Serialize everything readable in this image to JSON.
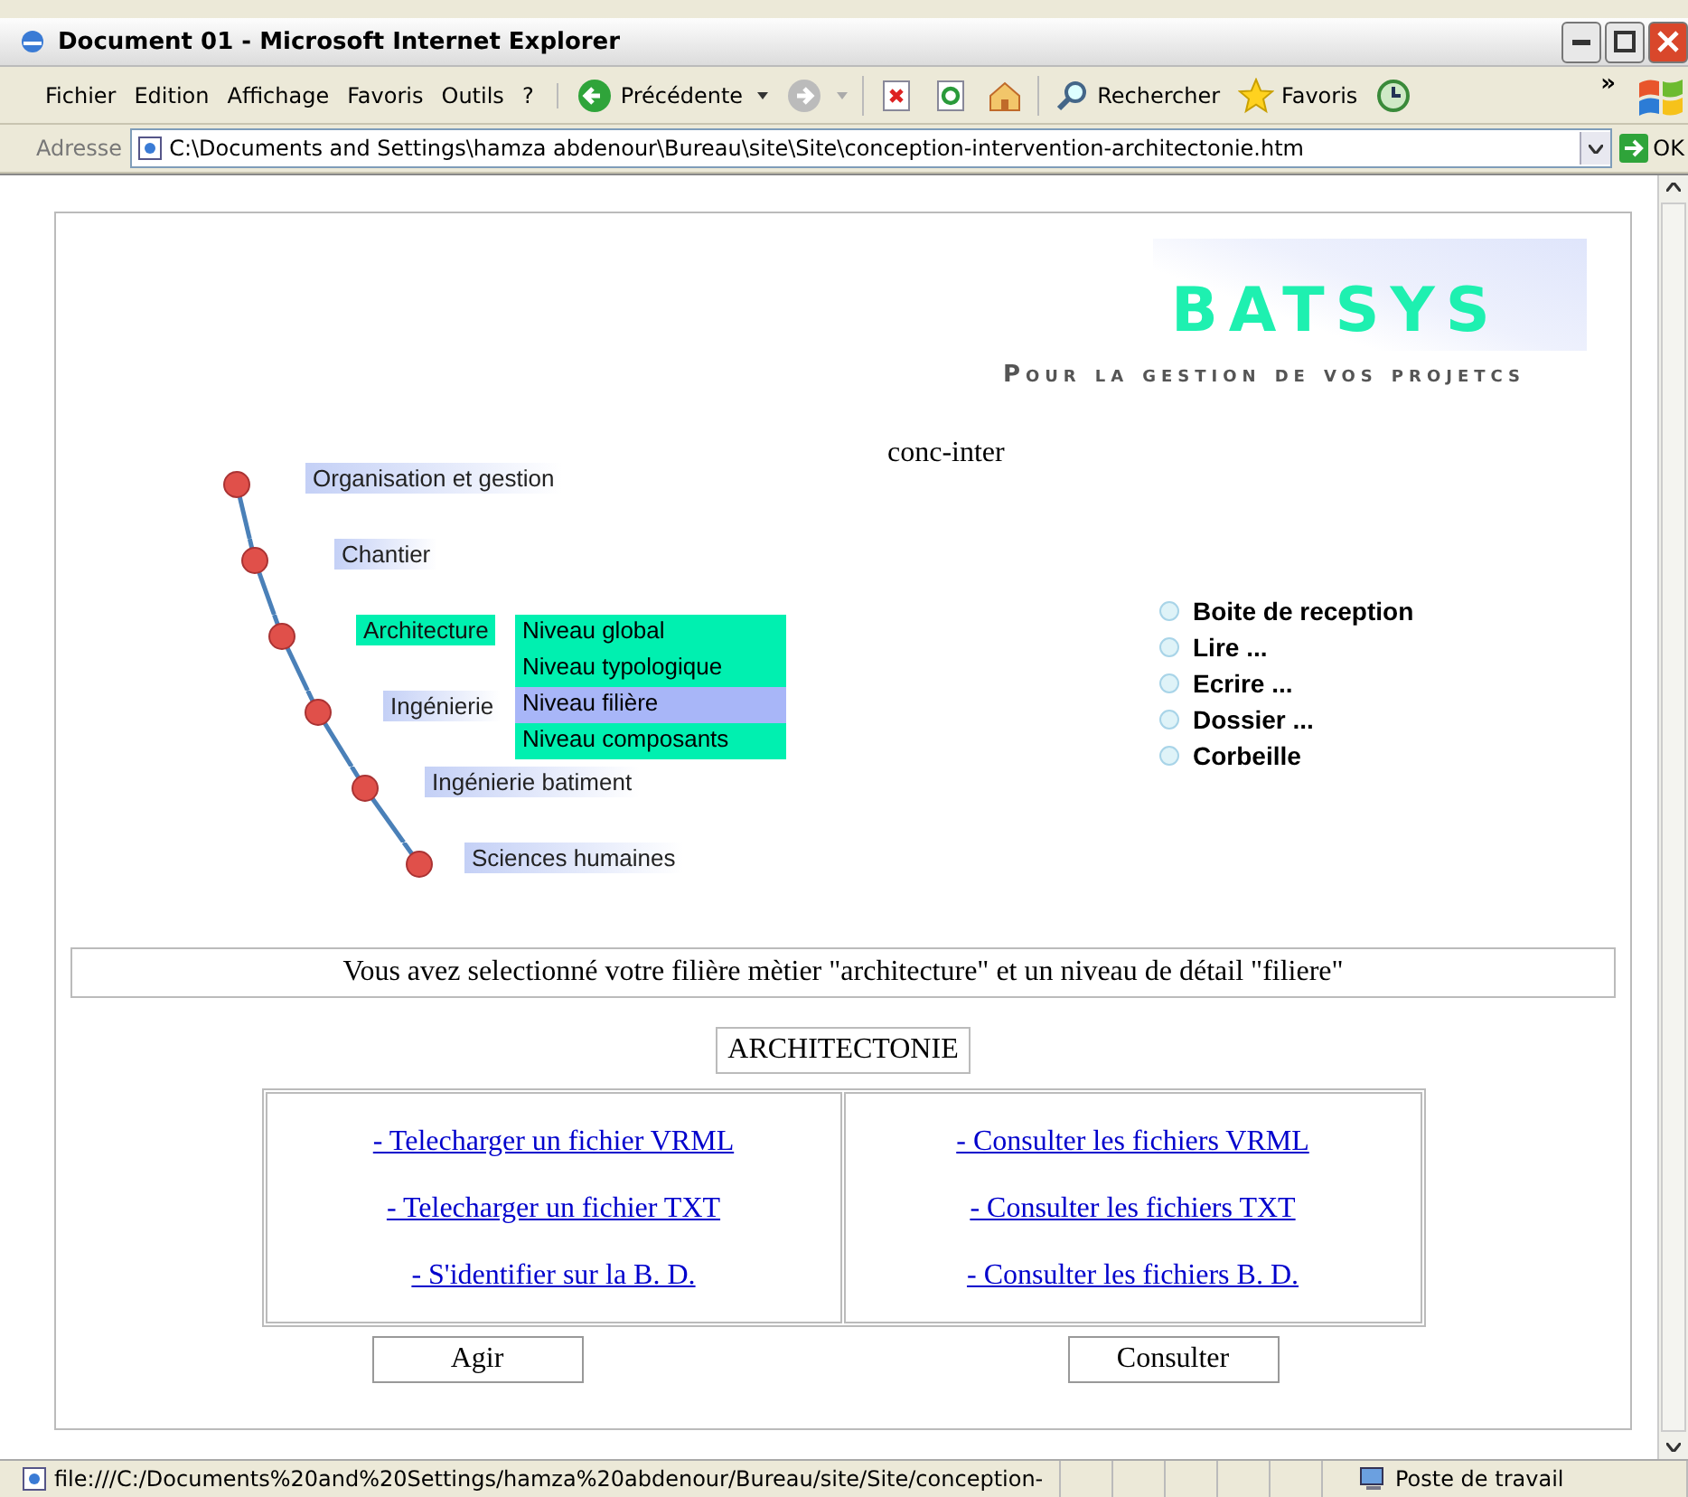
{
  "window": {
    "title": "Document 01 - Microsoft Internet Explorer"
  },
  "menu": [
    "Fichier",
    "Edition",
    "Affichage",
    "Favoris",
    "Outils",
    "?"
  ],
  "toolbar": [
    {
      "kind": "back",
      "label": "Précédente"
    },
    {
      "kind": "forward"
    },
    {
      "kind": "stop"
    },
    {
      "kind": "refresh"
    },
    {
      "kind": "home"
    },
    {
      "kind": "search",
      "label": "Rechercher"
    },
    {
      "kind": "favorites",
      "label": "Favoris"
    },
    {
      "kind": "history"
    }
  ],
  "toolbar_more": "»",
  "address": {
    "label": "Adresse",
    "value": "C:\\Documents and Settings\\hamza abdenour\\Bureau\\site\\Site\\conception-intervention-architectonie.htm",
    "go": "OK"
  },
  "page": {
    "logo": "BATSYS",
    "tagline": "Pour la gestion de vos projetcs",
    "page_label": "conc-inter",
    "nav": [
      {
        "label": "Organisation et gestion",
        "selected": false
      },
      {
        "label": "Chantier",
        "selected": false
      },
      {
        "label": "Architecture",
        "selected": true
      },
      {
        "label": "Ingénierie",
        "selected": false
      },
      {
        "label": "Ingénierie batiment",
        "selected": false
      },
      {
        "label": "Sciences humaines",
        "selected": false
      }
    ],
    "submenu": [
      {
        "label": "Niveau global",
        "selected": false
      },
      {
        "label": "Niveau typologique",
        "selected": false
      },
      {
        "label": "Niveau filière",
        "selected": true
      },
      {
        "label": "Niveau composants",
        "selected": false
      }
    ],
    "mail": [
      "Boite de reception",
      "Lire ...",
      "Ecrire ...",
      "Dossier ...",
      "Corbeille"
    ],
    "message": "Vous avez selectionné votre filière mètier \"architecture\" et un niveau de détail \"filiere\"",
    "section": "ARCHITECTONIE",
    "links_left": [
      "- Telecharger un fichier VRML",
      "- Telecharger un fichier TXT",
      "- S'identifier sur la B. D."
    ],
    "links_right": [
      "- Consulter les fichiers VRML",
      "- Consulter les fichiers TXT",
      "- Consulter les fichiers B. D."
    ],
    "buttons": [
      "Agir",
      "Consulter"
    ]
  },
  "status_bar": {
    "url": "file:///C:/Documents%20and%20Settings/hamza%20abdenour/Bureau/site/Site/conception-",
    "zone": "Poste de travail"
  }
}
